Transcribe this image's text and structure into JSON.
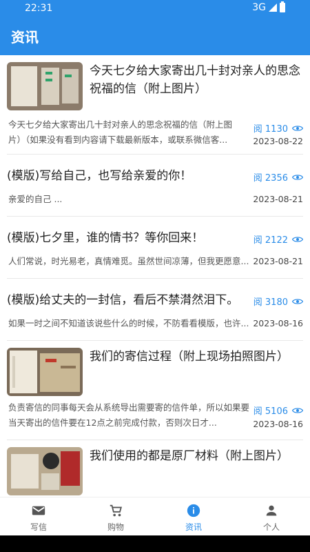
{
  "status": {
    "time": "22:31",
    "network": "3G"
  },
  "appbar": {
    "title": "资讯"
  },
  "items": [
    {
      "title": "今天七夕给大家寄出几十封对亲人的思念祝福的信（附上图片）",
      "excerpt": "今天七夕给大家寄出几十封对亲人的思念祝福的信（附上图片）（如果没有看到内容请下载最新版本，或联系微信客...",
      "reads": "阅 1130",
      "date": "2023-08-22"
    },
    {
      "title": "(模版)写给自己，也写给亲爱的你！",
      "excerpt": "亲爱的自己 ...",
      "reads": "阅 2356",
      "date": "2023-08-21"
    },
    {
      "title": "(模版)七夕里，谁的情书？等你回来！",
      "excerpt": "人们常说，时光易老，真情难觅。虽然世间凉薄，但我更愿意...",
      "reads": "阅 2122",
      "date": "2023-08-21"
    },
    {
      "title": "(模版)给丈夫的一封信，看后不禁潸然泪下。",
      "excerpt": "如果一时之间不知道该说些什么的时候，不防看看模版，也许...",
      "reads": "阅 3180",
      "date": "2023-08-16"
    },
    {
      "title": "我们的寄信过程（附上现场拍照图片）",
      "excerpt": "负责寄信的同事每天会从系统导出需要寄的信件单，所以如果要当天寄出的信件要在12点之前完成付款，否则次日才...",
      "reads": "阅 5106",
      "date": "2023-08-16"
    },
    {
      "title": "我们使用的都是原厂材料（附上图片）"
    }
  ],
  "tabs": [
    {
      "label": "写信",
      "icon": "mail-icon"
    },
    {
      "label": "购物",
      "icon": "cart-icon"
    },
    {
      "label": "资讯",
      "icon": "info-icon"
    },
    {
      "label": "个人",
      "icon": "person-icon"
    }
  ],
  "colors": {
    "primary": "#2a8ce8",
    "text": "#222222",
    "muted": "#555555"
  }
}
